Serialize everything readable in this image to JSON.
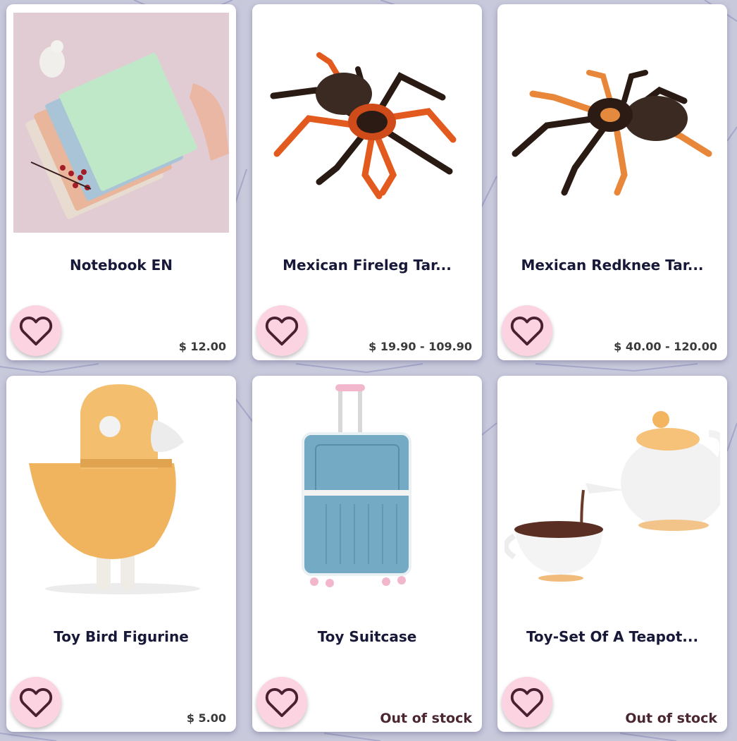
{
  "products": [
    {
      "title": "Notebook EN",
      "price": "$ 12.00",
      "image": "notebook-stack-image"
    },
    {
      "title": "Mexican Fireleg Tar...",
      "price": "$ 19.90 - 109.90",
      "image": "tarantula-image"
    },
    {
      "title": "Mexican Redknee Tar...",
      "price": "$ 40.00 - 120.00",
      "image": "tarantula-image"
    },
    {
      "title": "Toy Bird Figurine",
      "price": "$ 5.00",
      "image": "toy-bird-image"
    },
    {
      "title": "Toy Suitcase",
      "stock": "Out of stock",
      "image": "suitcase-image"
    },
    {
      "title": "Toy-Set Of A Teapot...",
      "stock": "Out of stock",
      "image": "teapot-set-image"
    }
  ],
  "icons": {
    "favorite": "heart-outline-icon"
  },
  "colors": {
    "background": "#c9c9dc",
    "favorite_bg": "#fbd3e1",
    "heart_stroke": "#4a2030",
    "title": "#181838"
  }
}
